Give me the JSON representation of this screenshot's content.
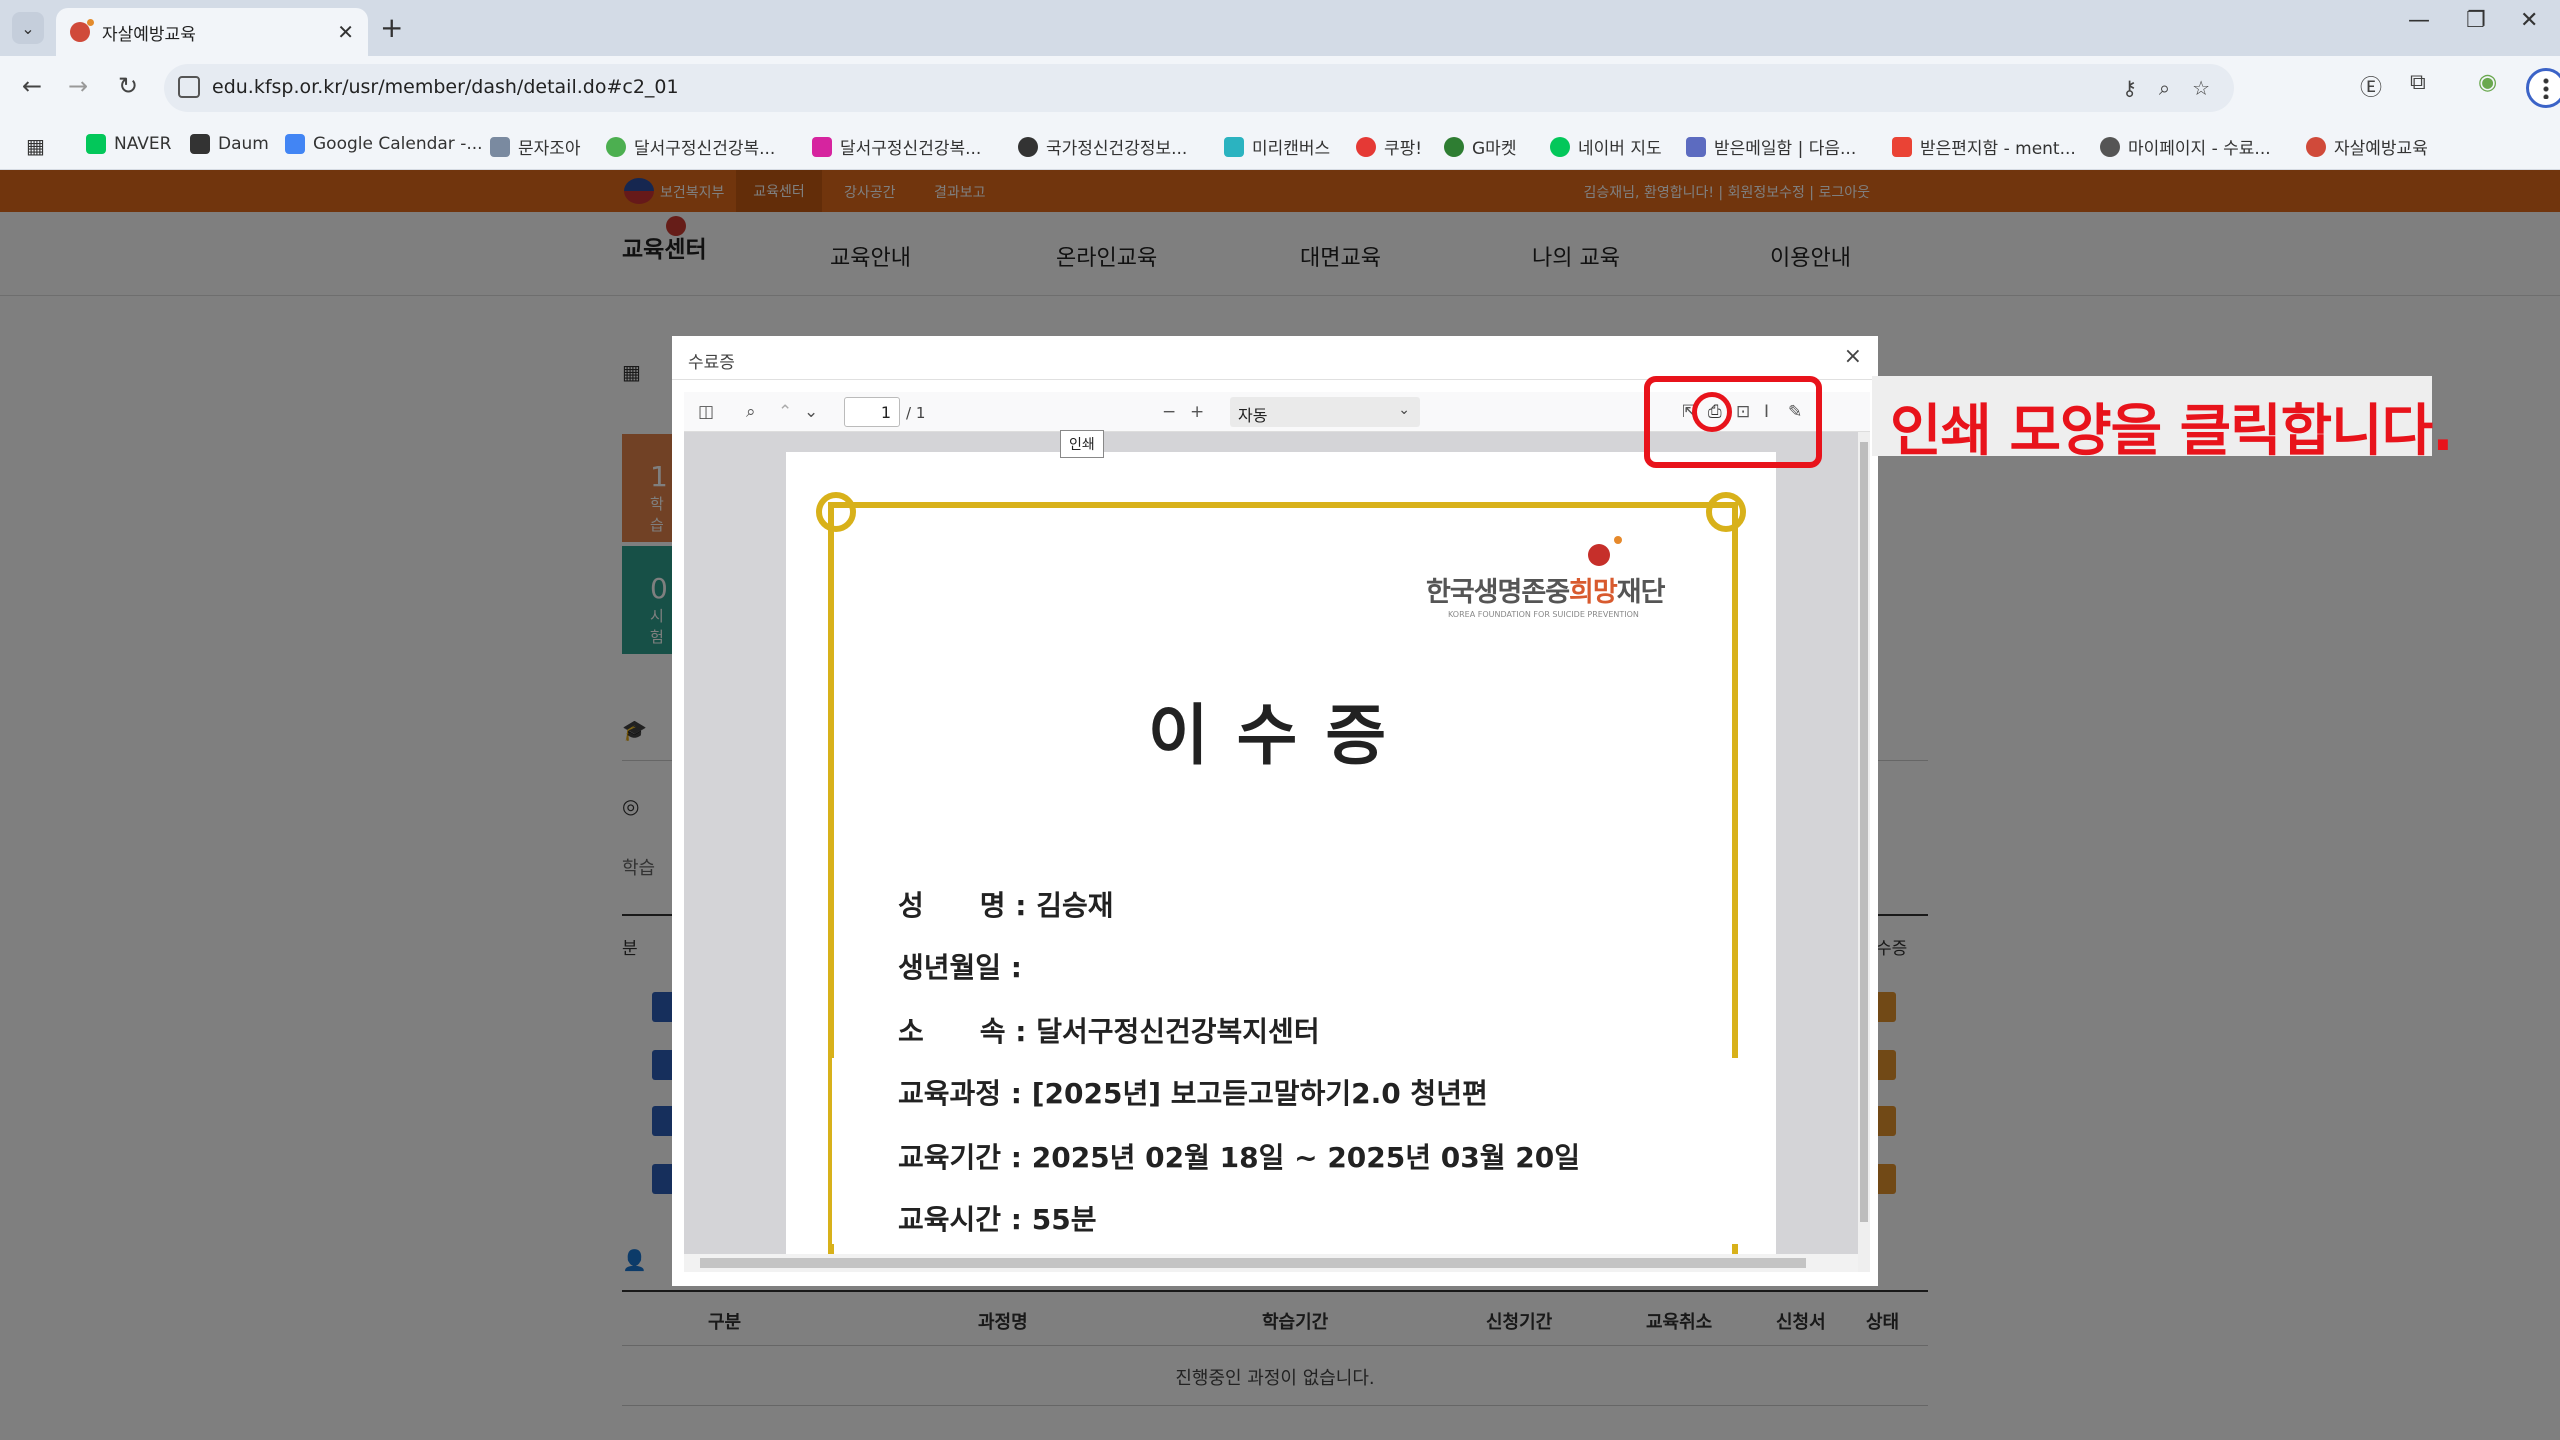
{
  "browser": {
    "tab_title": "자살예방교육",
    "url": "edu.kfsp.or.kr/usr/member/dash/detail.do#c2_01",
    "bookmarks": [
      {
        "label": "NAVER",
        "color": "#03c75a"
      },
      {
        "label": "Daum",
        "color": "#333333"
      },
      {
        "label": "Google Calendar -...",
        "color": "#4285f4"
      },
      {
        "label": "문자조아",
        "color": "#7a8aa0"
      },
      {
        "label": "달서구정신건강복...",
        "color": "#4caf50"
      },
      {
        "label": "달서구정신건강복...",
        "color": "#d6249f"
      },
      {
        "label": "국가정신건강정보...",
        "color": "#333333"
      },
      {
        "label": "미리캔버스",
        "color": "#2bb3c0"
      },
      {
        "label": "쿠팡!",
        "color": "#e53935"
      },
      {
        "label": "G마켓",
        "color": "#2e7d32"
      },
      {
        "label": "네이버 지도",
        "color": "#03c75a"
      },
      {
        "label": "받은메일함 | 다음...",
        "color": "#5c6bc0"
      },
      {
        "label": "받은편지함 - ment...",
        "color": "#ea4335"
      },
      {
        "label": "마이페이지 - 수료...",
        "color": "#555555"
      },
      {
        "label": "자살예방교육",
        "color": "#d04a3a"
      }
    ]
  },
  "site": {
    "topbar": {
      "gov_label": "보건복지부",
      "tabs": [
        "교육센터",
        "강사공간",
        "결과보고"
      ],
      "user_links": "김승재님, 환영합니다! | 회원정보수정 | 로그아웃"
    },
    "logo": "교육센터",
    "menu": [
      "교육안내",
      "온라인교육",
      "대면교육",
      "나의 교육",
      "이용안내"
    ],
    "stats": [
      {
        "num": "1",
        "label": "학습"
      },
      {
        "num": "0",
        "label": "시험"
      }
    ],
    "partial": {
      "search_hint": "학습",
      "col_left": "분",
      "col_right": "수증"
    },
    "table_headers": [
      "구분",
      "과정명",
      "학습기간",
      "신청기간",
      "교육취소",
      "신청서",
      "상태"
    ],
    "empty_message": "진행중인 과정이 없습니다."
  },
  "modal": {
    "title": "수료증",
    "close": "×",
    "toolbar": {
      "page": "1",
      "total": "/ 1",
      "zoom": "자동",
      "tooltip": "인쇄"
    },
    "certificate": {
      "org_prefix": "한국생명존중",
      "org_hope": "희망",
      "org_suffix": "재단",
      "org_en": "KOREA FOUNDATION FOR SUICIDE PREVENTION",
      "title": "이수증",
      "lines": [
        "성　　명 : 김승재",
        "생년월일 :",
        "소　　속 : 달서구정신건강복지센터",
        "교육과정 : [2025년] 보고듣고말하기2.0 청년편",
        "교육기간 : 2025년 02월 18일 ~ 2025년 03월 20일",
        "교육시간 : 55분"
      ]
    }
  },
  "annotation": {
    "text": "인쇄 모양을 클릭합니다.",
    "color": "#e8131b"
  }
}
